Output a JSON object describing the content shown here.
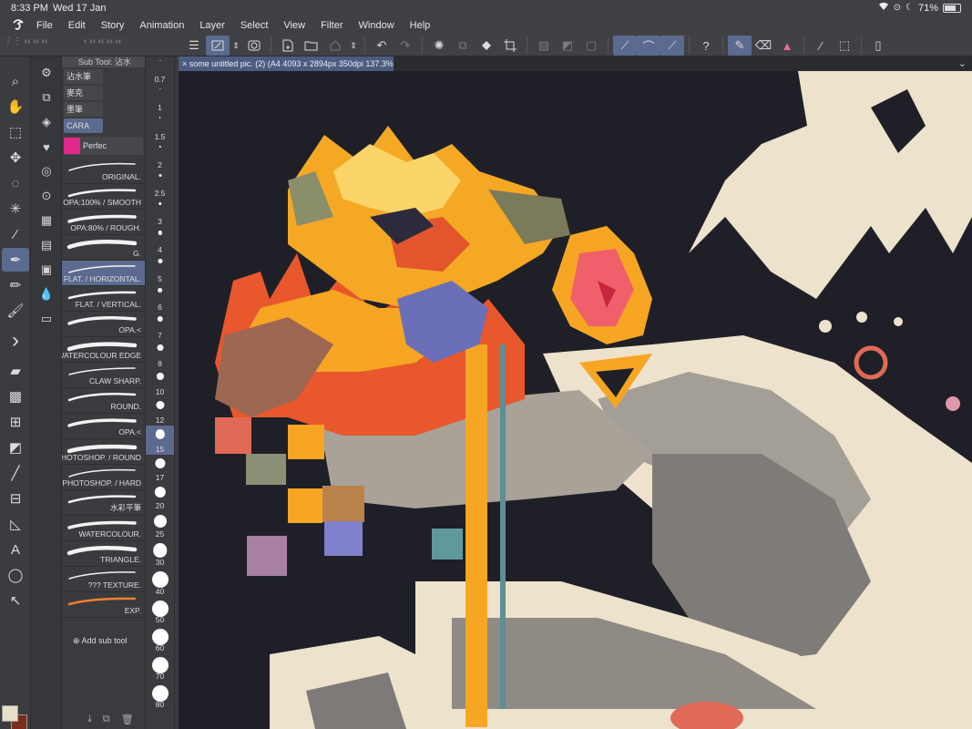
{
  "status": {
    "time": "8:33 PM",
    "date": "Wed 17 Jan",
    "battery": "71%"
  },
  "menu": [
    "File",
    "Edit",
    "Story",
    "Animation",
    "Layer",
    "Select",
    "View",
    "Filter",
    "Window",
    "Help"
  ],
  "document": {
    "tab_title": "some untitled pic. (2) (A4 4093 x 2894px 350dpi 137.3%)"
  },
  "sub_tool": {
    "header": "Sub Tool: 沾水",
    "tabs": [
      "沾水筆",
      "麥克",
      "墨筆",
      "CARA"
    ],
    "active_tab": "CARA",
    "group_label": "Perfec",
    "brushes": [
      "ORIGINAL.",
      "OPA:100% / SMOOTH",
      "OPA:80% / ROUGH.",
      "G.",
      "FLAT. / HORIZONTAL.",
      "FLAT. / VERTICAL.",
      "OPA.<",
      "w WATERCOLOUR EDGE",
      "CLAW SHARP.",
      "ROUND.",
      "OPA.<",
      "PHOTOSHOP. / ROUND",
      "PHOTOSHOP. / HARD",
      "水彩平筆",
      "WATERCOLOUR.",
      "TRIANGLE.",
      "??? TEXTURE.",
      "EXP."
    ],
    "active_brush": "FLAT. / HORIZONTAL.",
    "add_label": "Add sub tool"
  },
  "brush_sizes": [
    "0.7",
    "1",
    "1.5",
    "2",
    "2.5",
    "3",
    "4",
    "5",
    "6",
    "7",
    "8",
    "10",
    "12",
    "15",
    "17",
    "20",
    "25",
    "30",
    "40",
    "50",
    "60",
    "70",
    "80"
  ],
  "active_size": "15",
  "colors": {
    "main": "#e8dfc8",
    "sub": "#7a2d1b",
    "accent": "#5b6a8f"
  }
}
